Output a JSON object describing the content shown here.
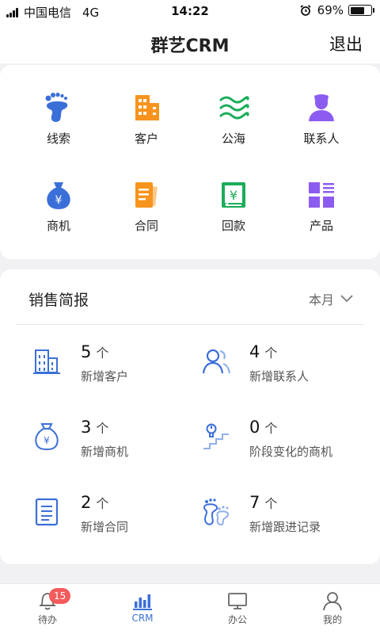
{
  "status_bar": {
    "carrier": "中国电信",
    "network": "4G",
    "time": "14:22",
    "battery": "69%",
    "battery_level": 0.69
  },
  "header": {
    "title": "群艺CRM",
    "logout": "退出"
  },
  "modules": [
    {
      "label": "线索",
      "icon": "footprint-icon"
    },
    {
      "label": "客户",
      "icon": "building-icon"
    },
    {
      "label": "公海",
      "icon": "waves-icon"
    },
    {
      "label": "联系人",
      "icon": "person-icon"
    },
    {
      "label": "商机",
      "icon": "money-bag-icon"
    },
    {
      "label": "合同",
      "icon": "contract-icon"
    },
    {
      "label": "回款",
      "icon": "payment-return-icon"
    },
    {
      "label": "产品",
      "icon": "product-grid-icon"
    }
  ],
  "sales_report": {
    "title": "销售简报",
    "period": "本月",
    "unit": "个",
    "stats": [
      {
        "value": "5",
        "label": "新增客户",
        "icon": "building-outline-icon"
      },
      {
        "value": "4",
        "label": "新增联系人",
        "icon": "contacts-outline-icon"
      },
      {
        "value": "3",
        "label": "新增商机",
        "icon": "money-bag-outline-icon"
      },
      {
        "value": "0",
        "label": "阶段变化的商机",
        "icon": "stage-stairs-icon"
      },
      {
        "value": "2",
        "label": "新增合同",
        "icon": "document-outline-icon"
      },
      {
        "value": "7",
        "label": "新增跟进记录",
        "icon": "followup-footprint-icon"
      }
    ]
  },
  "tabbar": {
    "badge": "15",
    "active": "crm",
    "tabs": [
      {
        "label": "待办",
        "icon": "bell-icon"
      },
      {
        "label": "CRM",
        "icon": "bar-chart-icon"
      },
      {
        "label": "办公",
        "icon": "monitor-icon"
      },
      {
        "label": "我的",
        "icon": "user-icon"
      }
    ]
  },
  "colors": {
    "accent": "#3b6fd8",
    "orange": "#f7941d",
    "green": "#1aad5a",
    "purple": "#8c5cf0",
    "badge": "#f45b5b"
  }
}
